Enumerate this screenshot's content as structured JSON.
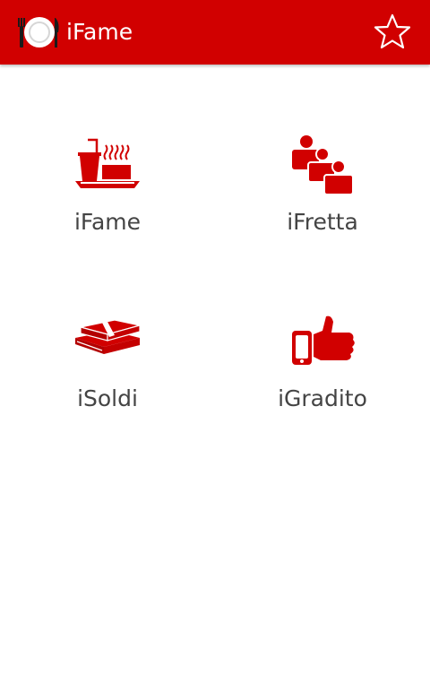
{
  "app": {
    "title": "iFame",
    "logo_icon": "plate-fork-knife-icon",
    "favorite_icon": "star-outline-icon"
  },
  "colors": {
    "accent": "#d10000",
    "label": "#444444",
    "background": "#ffffff"
  },
  "menu": {
    "items": [
      {
        "label": "iFame",
        "icon": "food-tray-icon"
      },
      {
        "label": "iFretta",
        "icon": "people-group-icon"
      },
      {
        "label": "iSoldi",
        "icon": "money-stack-icon"
      },
      {
        "label": "iGradito",
        "icon": "thumbs-up-phone-icon"
      }
    ]
  }
}
